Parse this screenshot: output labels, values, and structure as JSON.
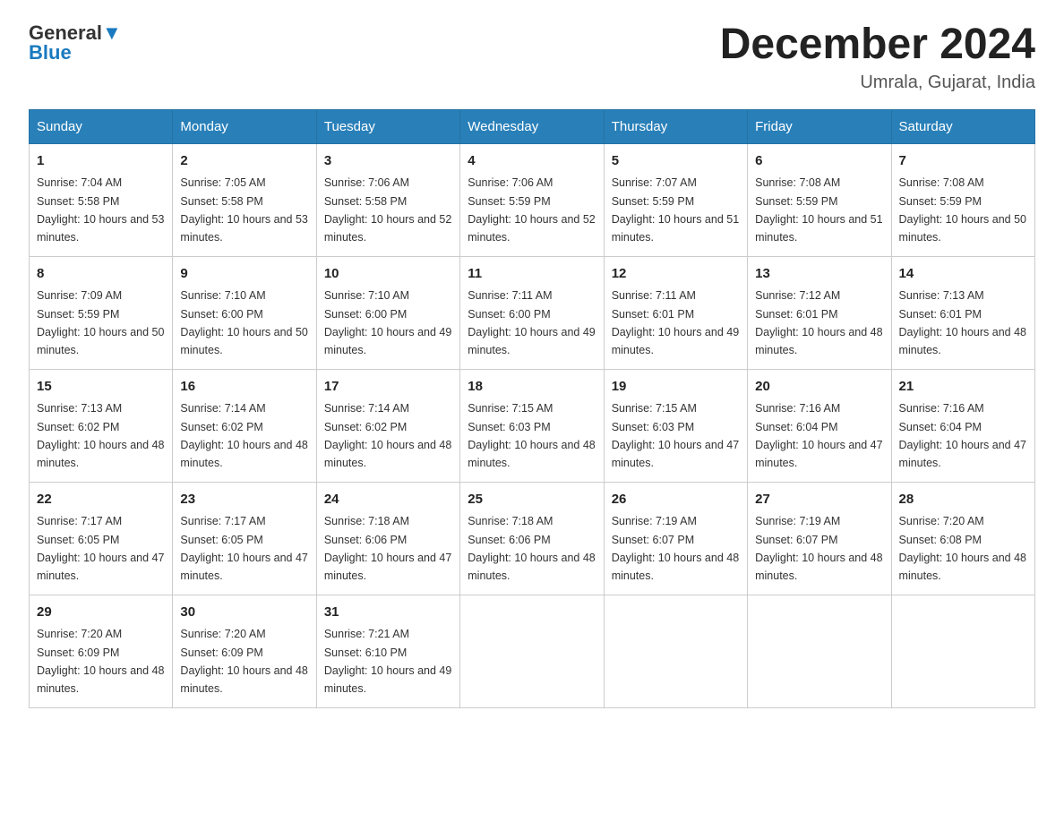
{
  "header": {
    "logo_general": "General",
    "logo_blue": "Blue",
    "month_title": "December 2024",
    "location": "Umrala, Gujarat, India"
  },
  "days_of_week": [
    "Sunday",
    "Monday",
    "Tuesday",
    "Wednesday",
    "Thursday",
    "Friday",
    "Saturday"
  ],
  "weeks": [
    [
      {
        "day": "1",
        "sunrise": "7:04 AM",
        "sunset": "5:58 PM",
        "daylight": "10 hours and 53 minutes."
      },
      {
        "day": "2",
        "sunrise": "7:05 AM",
        "sunset": "5:58 PM",
        "daylight": "10 hours and 53 minutes."
      },
      {
        "day": "3",
        "sunrise": "7:06 AM",
        "sunset": "5:58 PM",
        "daylight": "10 hours and 52 minutes."
      },
      {
        "day": "4",
        "sunrise": "7:06 AM",
        "sunset": "5:59 PM",
        "daylight": "10 hours and 52 minutes."
      },
      {
        "day": "5",
        "sunrise": "7:07 AM",
        "sunset": "5:59 PM",
        "daylight": "10 hours and 51 minutes."
      },
      {
        "day": "6",
        "sunrise": "7:08 AM",
        "sunset": "5:59 PM",
        "daylight": "10 hours and 51 minutes."
      },
      {
        "day": "7",
        "sunrise": "7:08 AM",
        "sunset": "5:59 PM",
        "daylight": "10 hours and 50 minutes."
      }
    ],
    [
      {
        "day": "8",
        "sunrise": "7:09 AM",
        "sunset": "5:59 PM",
        "daylight": "10 hours and 50 minutes."
      },
      {
        "day": "9",
        "sunrise": "7:10 AM",
        "sunset": "6:00 PM",
        "daylight": "10 hours and 50 minutes."
      },
      {
        "day": "10",
        "sunrise": "7:10 AM",
        "sunset": "6:00 PM",
        "daylight": "10 hours and 49 minutes."
      },
      {
        "day": "11",
        "sunrise": "7:11 AM",
        "sunset": "6:00 PM",
        "daylight": "10 hours and 49 minutes."
      },
      {
        "day": "12",
        "sunrise": "7:11 AM",
        "sunset": "6:01 PM",
        "daylight": "10 hours and 49 minutes."
      },
      {
        "day": "13",
        "sunrise": "7:12 AM",
        "sunset": "6:01 PM",
        "daylight": "10 hours and 48 minutes."
      },
      {
        "day": "14",
        "sunrise": "7:13 AM",
        "sunset": "6:01 PM",
        "daylight": "10 hours and 48 minutes."
      }
    ],
    [
      {
        "day": "15",
        "sunrise": "7:13 AM",
        "sunset": "6:02 PM",
        "daylight": "10 hours and 48 minutes."
      },
      {
        "day": "16",
        "sunrise": "7:14 AM",
        "sunset": "6:02 PM",
        "daylight": "10 hours and 48 minutes."
      },
      {
        "day": "17",
        "sunrise": "7:14 AM",
        "sunset": "6:02 PM",
        "daylight": "10 hours and 48 minutes."
      },
      {
        "day": "18",
        "sunrise": "7:15 AM",
        "sunset": "6:03 PM",
        "daylight": "10 hours and 48 minutes."
      },
      {
        "day": "19",
        "sunrise": "7:15 AM",
        "sunset": "6:03 PM",
        "daylight": "10 hours and 47 minutes."
      },
      {
        "day": "20",
        "sunrise": "7:16 AM",
        "sunset": "6:04 PM",
        "daylight": "10 hours and 47 minutes."
      },
      {
        "day": "21",
        "sunrise": "7:16 AM",
        "sunset": "6:04 PM",
        "daylight": "10 hours and 47 minutes."
      }
    ],
    [
      {
        "day": "22",
        "sunrise": "7:17 AM",
        "sunset": "6:05 PM",
        "daylight": "10 hours and 47 minutes."
      },
      {
        "day": "23",
        "sunrise": "7:17 AM",
        "sunset": "6:05 PM",
        "daylight": "10 hours and 47 minutes."
      },
      {
        "day": "24",
        "sunrise": "7:18 AM",
        "sunset": "6:06 PM",
        "daylight": "10 hours and 47 minutes."
      },
      {
        "day": "25",
        "sunrise": "7:18 AM",
        "sunset": "6:06 PM",
        "daylight": "10 hours and 48 minutes."
      },
      {
        "day": "26",
        "sunrise": "7:19 AM",
        "sunset": "6:07 PM",
        "daylight": "10 hours and 48 minutes."
      },
      {
        "day": "27",
        "sunrise": "7:19 AM",
        "sunset": "6:07 PM",
        "daylight": "10 hours and 48 minutes."
      },
      {
        "day": "28",
        "sunrise": "7:20 AM",
        "sunset": "6:08 PM",
        "daylight": "10 hours and 48 minutes."
      }
    ],
    [
      {
        "day": "29",
        "sunrise": "7:20 AM",
        "sunset": "6:09 PM",
        "daylight": "10 hours and 48 minutes."
      },
      {
        "day": "30",
        "sunrise": "7:20 AM",
        "sunset": "6:09 PM",
        "daylight": "10 hours and 48 minutes."
      },
      {
        "day": "31",
        "sunrise": "7:21 AM",
        "sunset": "6:10 PM",
        "daylight": "10 hours and 49 minutes."
      },
      null,
      null,
      null,
      null
    ]
  ]
}
